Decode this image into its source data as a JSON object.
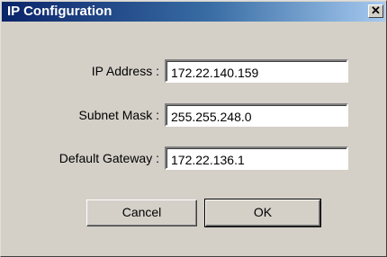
{
  "window": {
    "title": "IP Configuration",
    "close_glyph": "✕"
  },
  "fields": {
    "ip_address": {
      "label": "IP Address :",
      "value": "172.22.140.159"
    },
    "subnet_mask": {
      "label": "Subnet Mask :",
      "value": "255.255.248.0"
    },
    "default_gateway": {
      "label": "Default Gateway :",
      "value": "172.22.136.1"
    }
  },
  "buttons": {
    "cancel_label": "Cancel",
    "ok_label": "OK"
  },
  "colors": {
    "dialog_face": "#d4d0c8",
    "titlebar_start": "#0a246a",
    "titlebar_end": "#a6caf0"
  },
  "icons": {
    "close": "close-icon"
  }
}
